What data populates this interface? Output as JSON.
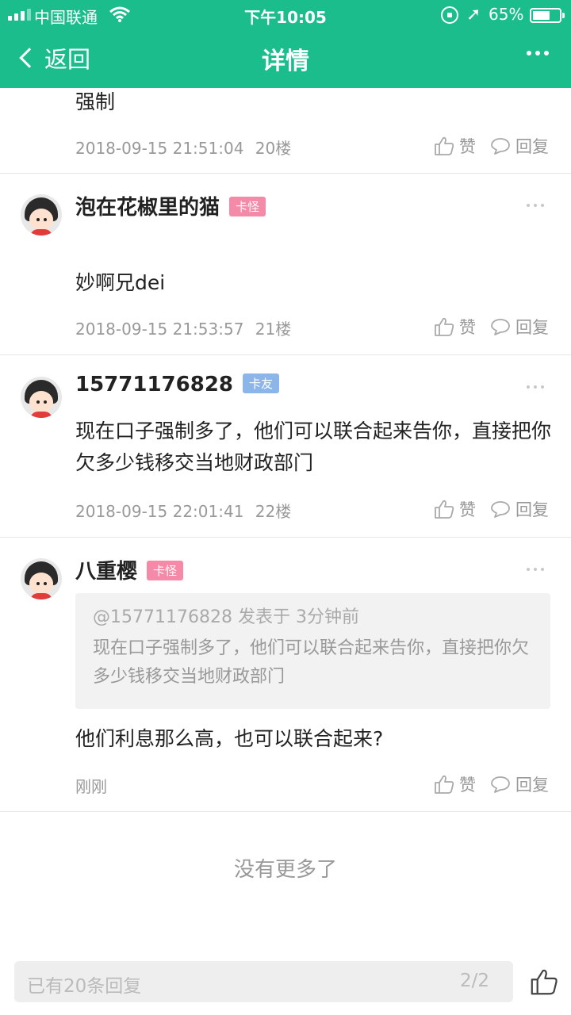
{
  "status_bar": {
    "carrier": "中国联通",
    "time": "下午10:05",
    "battery_percent": "65%",
    "battery_level": 0.65,
    "location_arrow": "➚"
  },
  "nav": {
    "back_label": "返回",
    "title": "详情"
  },
  "posts": [
    {
      "content": "强制",
      "time": "2018-09-15 21:51:04",
      "floor": "20楼",
      "like_label": "赞",
      "reply_label": "回复"
    },
    {
      "username": "泡在花椒里的猫",
      "badge": "卡怪",
      "content": "妙啊兄dei",
      "time": "2018-09-15 21:53:57",
      "floor": "21楼",
      "like_label": "赞",
      "reply_label": "回复"
    },
    {
      "username": "15771176828",
      "badge": "卡友",
      "content": "现在口子强制多了，他们可以联合起来告你，直接把你欠多少钱移交当地财政部门",
      "time": "2018-09-15 22:01:41",
      "floor": "22楼",
      "like_label": "赞",
      "reply_label": "回复"
    },
    {
      "username": "八重樱",
      "badge": "卡怪",
      "quote_header": "@15771176828 发表于 3分钟前",
      "quote_text": "现在口子强制多了，他们可以联合起来告你，直接把你欠多少钱移交当地财政部门",
      "content": "他们利息那么高，也可以联合起来?",
      "time": "刚刚",
      "like_label": "赞",
      "reply_label": "回复"
    }
  ],
  "footer_note": "没有更多了",
  "input_bar": {
    "placeholder": "已有20条回复",
    "page_indicator": "2/2"
  },
  "icons": {
    "signal": "signal-icon",
    "wifi": "wifi-icon",
    "battery": "battery-icon",
    "like": "thumbs-up-icon",
    "reply": "chat-bubble-icon",
    "more": "more-icon"
  },
  "colors": {
    "header_bg": "#1cbd8c",
    "badge_pink": "#f48aa8",
    "badge_blue": "#8cb6ea"
  }
}
